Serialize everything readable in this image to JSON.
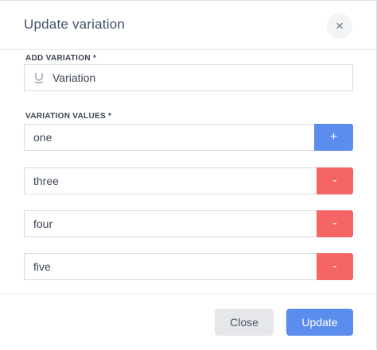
{
  "modal": {
    "title": "Update variation",
    "close_icon": "×"
  },
  "add_variation": {
    "label": "ADD VARIATION *",
    "icon": "underline-icon",
    "value": "Variation"
  },
  "variation_values": {
    "label": "VARIATION VALUES *",
    "items": [
      {
        "value": "one",
        "action": "+"
      },
      {
        "value": "three",
        "action": "-"
      },
      {
        "value": "four",
        "action": "-"
      },
      {
        "value": "five",
        "action": "-"
      }
    ]
  },
  "footer": {
    "close_label": "Close",
    "update_label": "Update"
  },
  "colors": {
    "primary": "#5b8def",
    "danger": "#f56565",
    "secondary": "#e5e7eb"
  }
}
